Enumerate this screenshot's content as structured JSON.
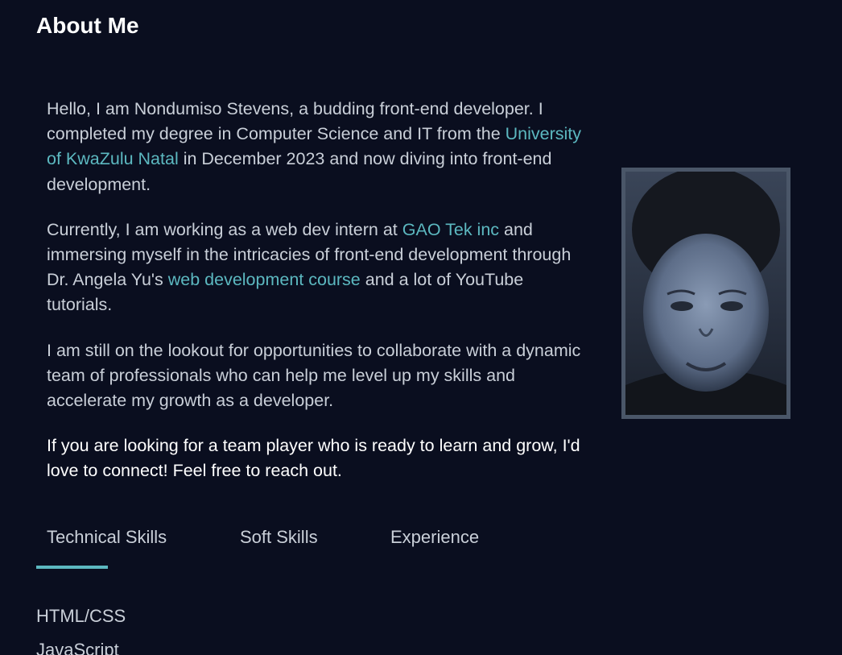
{
  "about": {
    "title": "About Me",
    "p1": {
      "before": "Hello, I am Nondumiso Stevens, a budding front-end developer. I completed my degree in Computer Science and IT from the ",
      "link": "University of KwaZulu Natal",
      "after": " in December 2023 and now diving into front-end development."
    },
    "p2": {
      "before": "Currently, I am working as a web dev intern at ",
      "link1": "GAO Tek inc",
      "middle": " and immersing myself in the intricacies of front-end development through Dr. Angela Yu's ",
      "link2": "web development course",
      "after": " and a lot of YouTube tutorials."
    },
    "p3": "I am still on the lookout for opportunities to collaborate with a dynamic team of professionals who can help me level up my skills and accelerate my growth as a developer.",
    "p4": "If you are looking for a team player who is ready to learn and grow, I'd love to connect! Feel free to reach out."
  },
  "tabs": [
    {
      "label": "Technical Skills",
      "active": true
    },
    {
      "label": "Soft Skills",
      "active": false
    },
    {
      "label": "Experience",
      "active": false
    }
  ],
  "skills": [
    "HTML/CSS",
    "JavaScript"
  ],
  "colors": {
    "background": "#0a0e1f",
    "accent": "#5cb8c0",
    "text": "#c9cfd8",
    "frame": "#4a5668"
  }
}
